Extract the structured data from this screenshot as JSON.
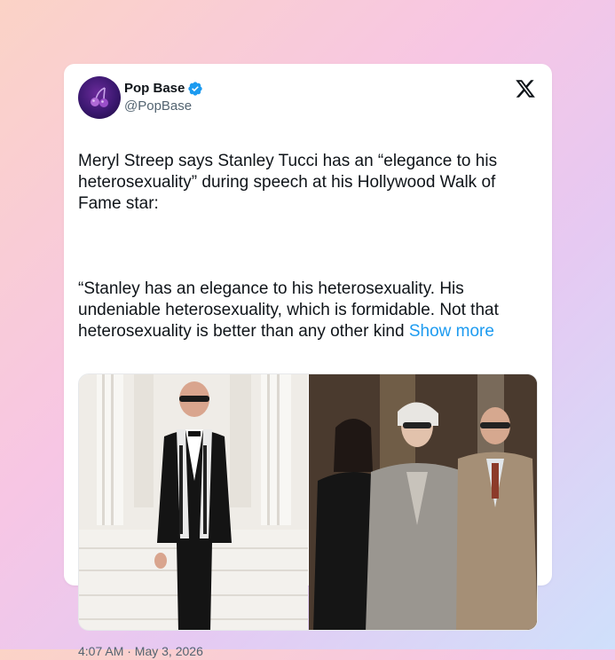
{
  "author": {
    "name": "Pop Base",
    "handle": "@PopBase",
    "verified": true
  },
  "platform_icon": "x-logo-icon",
  "tweet": {
    "paragraph1": "Meryl Streep says Stanley Tucci has an “elegance to his heterosexuality” during speech at his Hollywood Walk of Fame star:",
    "paragraph2": "“Stanley has an elegance to his heterosexuality. His undeniable heterosexuality, which is formidable. Not that heterosexuality is better than any other kind",
    "show_more": "Show more"
  },
  "media": [
    {
      "name": "photo-left"
    },
    {
      "name": "photo-right"
    }
  ],
  "timestamp": "4:07 AM · May 3, 2026",
  "colors": {
    "accent": "#1d9bf0",
    "text": "#0f1419",
    "secondary": "#536471"
  }
}
